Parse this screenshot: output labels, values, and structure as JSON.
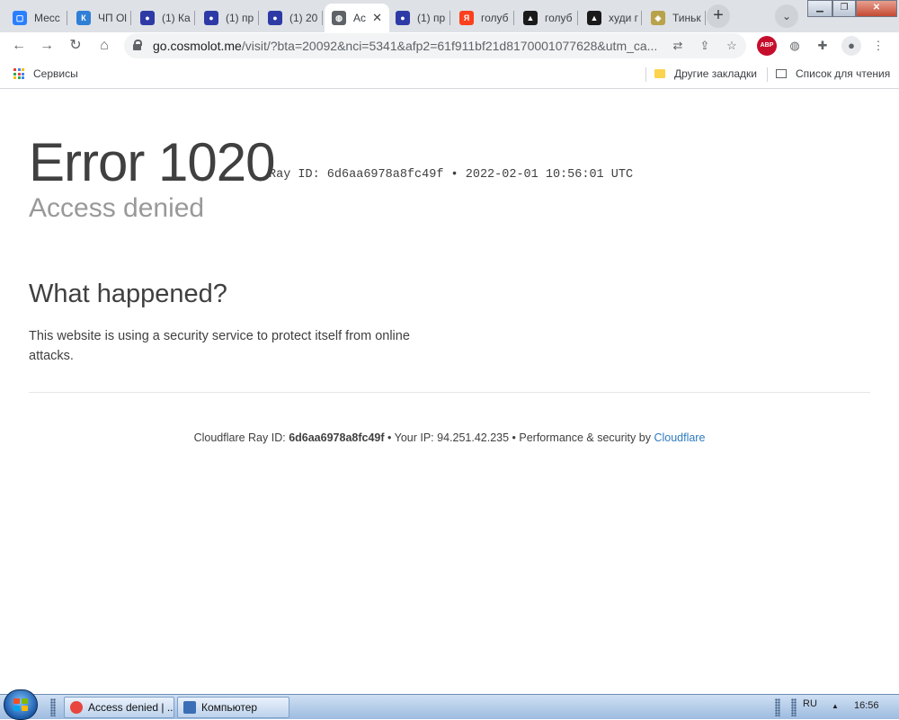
{
  "browser": {
    "tabs": [
      {
        "label": "Месс",
        "fav_color": "#2b7fff",
        "fav_glyph": "▢"
      },
      {
        "label": "ЧП Ol",
        "fav_color": "#2f7fd6",
        "fav_glyph": "К"
      },
      {
        "label": "(1) Ка",
        "fav_color": "#2d3aa6",
        "fav_glyph": "●"
      },
      {
        "label": "(1) пр",
        "fav_color": "#2d3aa6",
        "fav_glyph": "●"
      },
      {
        "label": "(1) 20",
        "fav_color": "#2d3aa6",
        "fav_glyph": "●"
      },
      {
        "label": "Ac",
        "fav_color": "#5f6368",
        "fav_glyph": "◍",
        "active": true
      },
      {
        "label": "(1) пр",
        "fav_color": "#2d3aa6",
        "fav_glyph": "●"
      },
      {
        "label": "голуб",
        "fav_color": "#fc3f1d",
        "fav_glyph": "Я"
      },
      {
        "label": "голуб",
        "fav_color": "#1a1a1a",
        "fav_glyph": "▲"
      },
      {
        "label": "худи г",
        "fav_color": "#1a1a1a",
        "fav_glyph": "▲"
      },
      {
        "label": "Тиньк",
        "fav_color": "#b8a24a",
        "fav_glyph": "◈"
      }
    ],
    "new_tab_symbol": "+",
    "tab_search_icon": "chevron-down-icon",
    "url_host": "go.cosmolot.me",
    "url_rest": "/visit/?bta=20092&nci=5341&afp2=61f911bf21d8170001077628&utm_ca...",
    "bookmarks": {
      "apps_label": "Сервисы",
      "other_label": "Другие закладки",
      "reading_label": "Список для чтения"
    }
  },
  "page": {
    "error_title": "Error 1020",
    "ray_line": "Ray ID: 6d6aa6978a8fc49f • 2022-02-01 10:56:01 UTC",
    "subtitle": "Access denied",
    "what_heading": "What happened?",
    "what_text": "This website is using a security service to protect itself from online attacks.",
    "footer": {
      "ray_prefix": "Cloudflare Ray ID: ",
      "ray_id": "6d6aa6978a8fc49f",
      "ip_text": " • Your IP: 94.251.42.235 • Performance & security by ",
      "link": "Cloudflare"
    }
  },
  "taskbar": {
    "items": [
      {
        "label": "Access denied | ...",
        "icon_color": "#e8453c"
      },
      {
        "label": "Компьютер",
        "icon_color": "#3a6fb5"
      }
    ],
    "lang": "RU",
    "tray_arrow": "▲",
    "clock": "16:56"
  },
  "colors": {
    "link": "#2f7bbf",
    "text": "#404040",
    "muted": "#999999"
  }
}
